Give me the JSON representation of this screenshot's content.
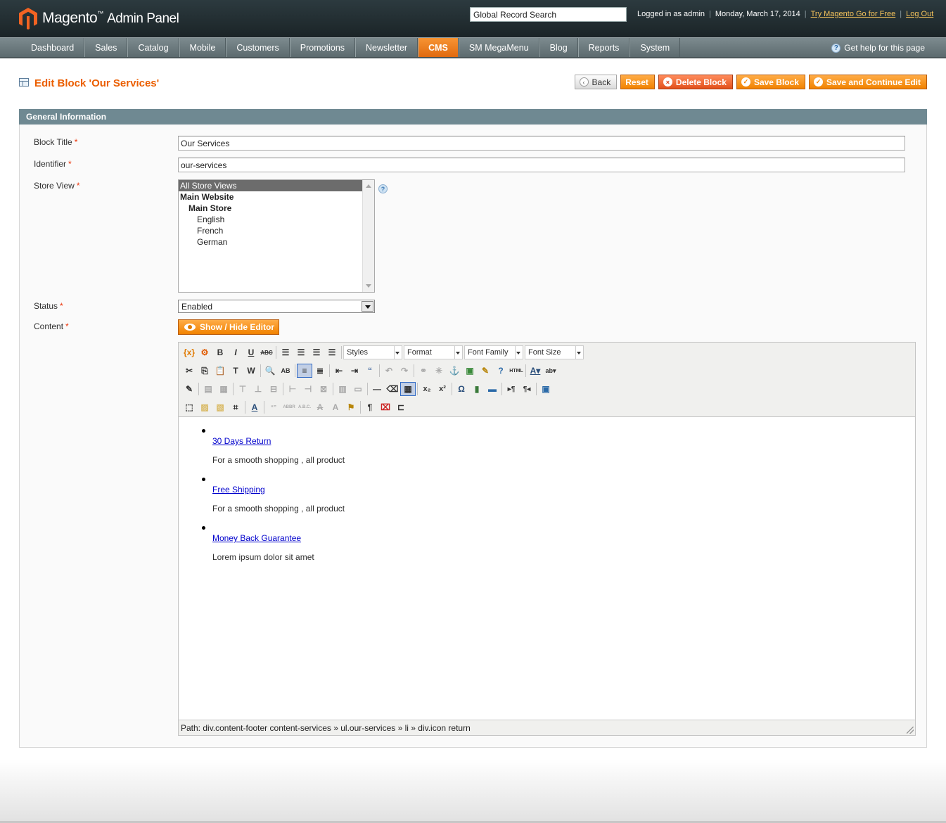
{
  "header": {
    "brand": "Magento",
    "brand_tm": "™",
    "brand_suffix": "Admin Panel",
    "search_value": "Global Record Search",
    "logged_in": "Logged in as admin",
    "date": "Monday, March 17, 2014",
    "try_link": "Try Magento Go for Free",
    "logout": "Log Out"
  },
  "nav": {
    "items": [
      "Dashboard",
      "Sales",
      "Catalog",
      "Mobile",
      "Customers",
      "Promotions",
      "Newsletter",
      "CMS",
      "SM MegaMenu",
      "Blog",
      "Reports",
      "System"
    ],
    "active": "CMS",
    "help": "Get help for this page"
  },
  "page": {
    "title": "Edit Block 'Our Services'",
    "buttons": {
      "back": "Back",
      "reset": "Reset",
      "delete": "Delete Block",
      "save": "Save Block",
      "save_continue": "Save and Continue Edit"
    }
  },
  "form": {
    "section_title": "General Information",
    "block_title_label": "Block Title",
    "block_title_value": "Our Services",
    "identifier_label": "Identifier",
    "identifier_value": "our-services",
    "store_view_label": "Store View",
    "store_options": [
      "All Store Views",
      "Main Website",
      "Main Store",
      "English",
      "French",
      "German"
    ],
    "status_label": "Status",
    "status_value": "Enabled",
    "content_label": "Content",
    "required_marker": "*",
    "toggle_editor": "Show / Hide Editor"
  },
  "editor": {
    "selects": [
      "Styles",
      "Format",
      "Font Family",
      "Font Size"
    ],
    "items": [
      {
        "title": "30 Days Return",
        "desc": "For a smooth shopping , all product"
      },
      {
        "title": "Free Shipping",
        "desc": "For a smooth shopping , all product"
      },
      {
        "title": "Money Back Guarantee",
        "desc": "Lorem ipsum dolor sit amet"
      }
    ],
    "path": "Path: div.content-footer content-services » ul.our-services » li » div.icon return"
  },
  "colors": {
    "accent": "#eb5e00",
    "header_bg": "#1b2427",
    "nav_bg": "#6b797d",
    "section_bg": "#6f8992",
    "link": "#0000cc"
  }
}
